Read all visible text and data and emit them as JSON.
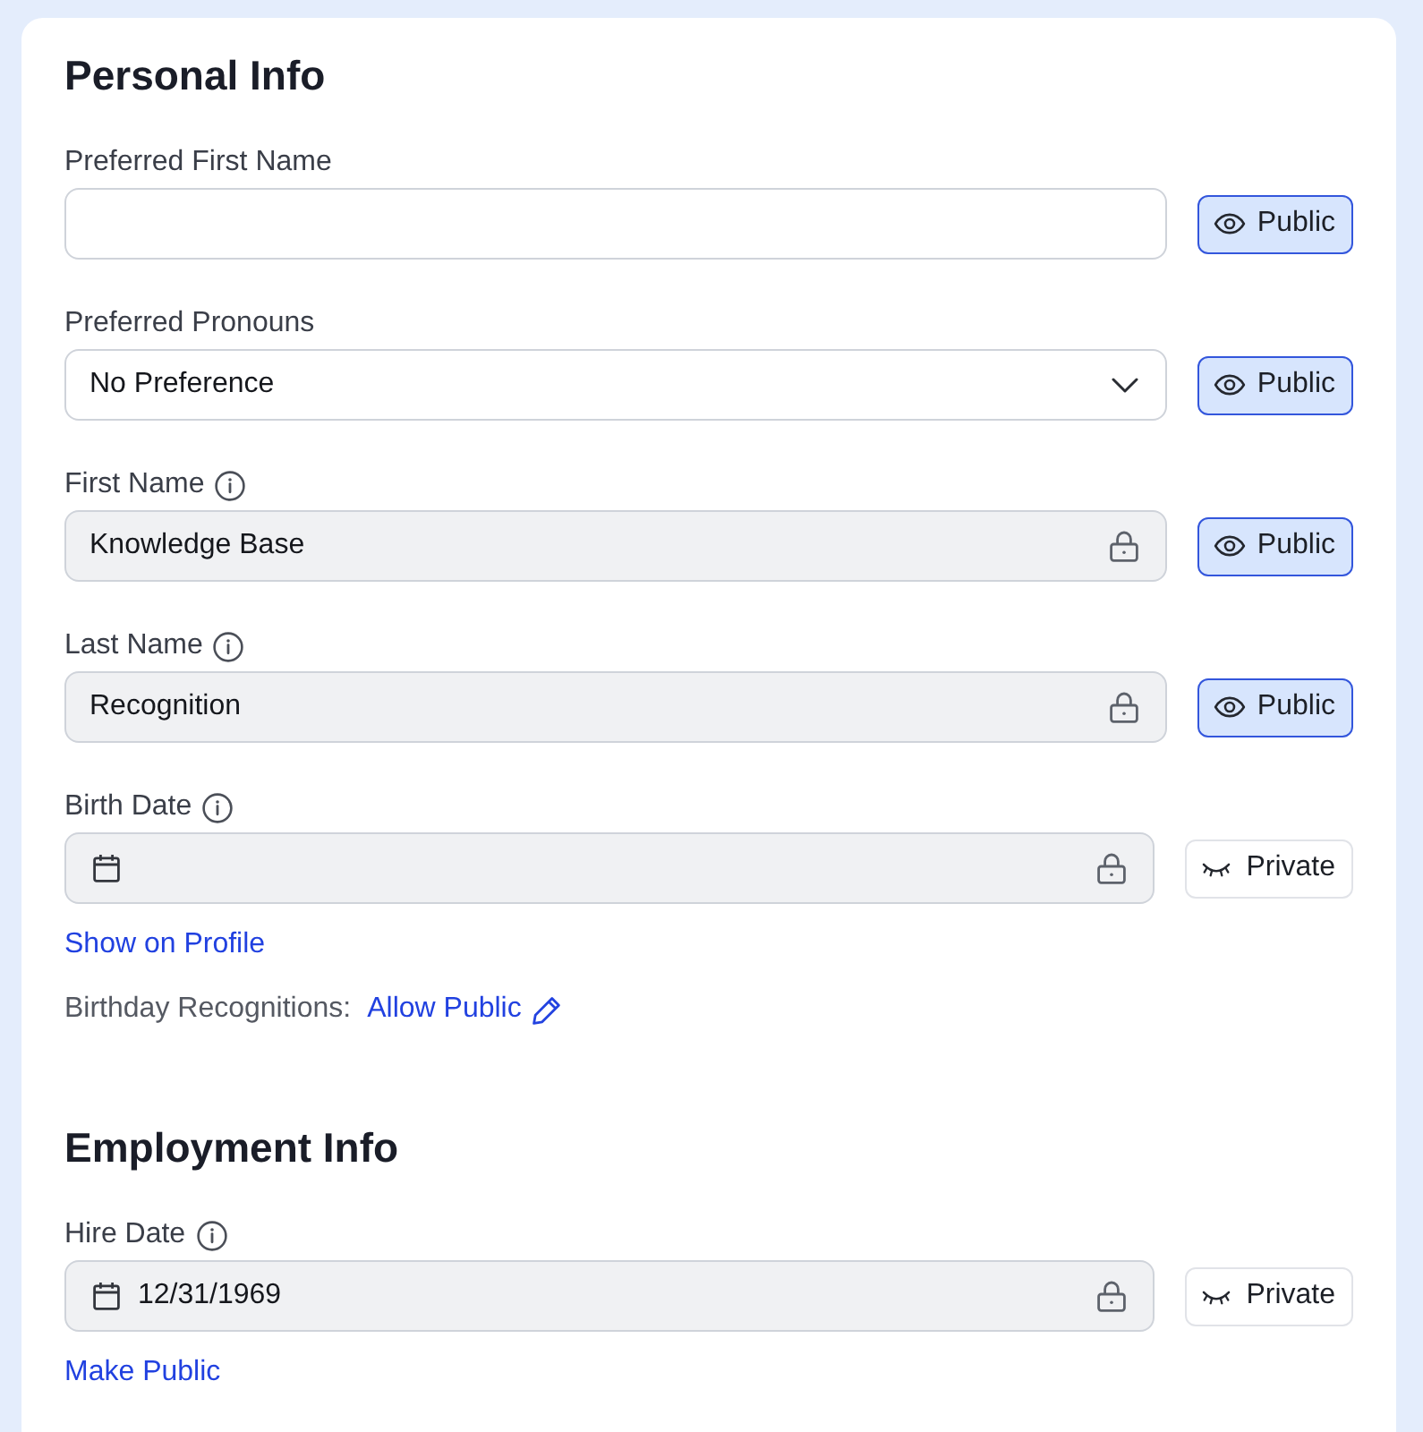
{
  "sections": [
    {
      "title": "Personal Info",
      "fields": [
        {
          "label": "Preferred First Name",
          "info": false,
          "kind": "text",
          "locked": false,
          "visibility": {
            "label": "Public",
            "on": true
          }
        },
        {
          "label": "Preferred Pronouns",
          "info": false,
          "kind": "select",
          "value": "No Preference",
          "locked": false,
          "visibility": {
            "label": "Public",
            "on": true
          }
        },
        {
          "label": "First Name",
          "info": true,
          "kind": "text",
          "value": "Knowledge Base",
          "locked": true,
          "visibility": {
            "label": "Public",
            "on": true
          }
        },
        {
          "label": "Last Name",
          "info": true,
          "kind": "text",
          "value": "Recognition",
          "locked": true,
          "visibility": {
            "label": "Public",
            "on": true
          }
        },
        {
          "label": "Birth Date",
          "info": true,
          "kind": "date",
          "locked": true,
          "visibility": {
            "label": "Private",
            "on": false
          },
          "extras": [
            {
              "kind": "link",
              "text": "Show on Profile"
            },
            {
              "kind": "setting",
              "label": "Birthday Recognitions:",
              "link": "Allow Public"
            }
          ]
        }
      ]
    },
    {
      "title": "Employment Info",
      "fields": [
        {
          "label": "Hire Date",
          "info": true,
          "kind": "date",
          "value": "12/31/1969",
          "locked": true,
          "visibility": {
            "label": "Private",
            "on": false
          },
          "extras": [
            {
              "kind": "link",
              "text": "Make Public"
            }
          ]
        }
      ]
    }
  ]
}
